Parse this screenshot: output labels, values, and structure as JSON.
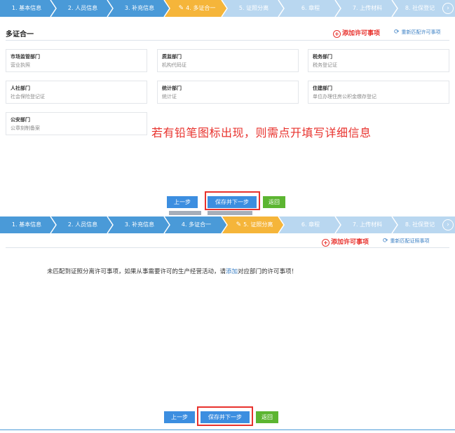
{
  "panel1": {
    "steps": [
      {
        "label": "1. 基本信息",
        "state": "done"
      },
      {
        "label": "2. 人员信息",
        "state": "done"
      },
      {
        "label": "3. 补充信息",
        "state": "done"
      },
      {
        "label": "4. 多证合一",
        "state": "current"
      },
      {
        "label": "5. 证照分离",
        "state": "todo"
      },
      {
        "label": "6. 章程",
        "state": "todo"
      },
      {
        "label": "7. 上传材料",
        "state": "todo"
      },
      {
        "label": "8. 社保登记",
        "state": "todo"
      }
    ],
    "next_arrow": "›",
    "section_title": "多证合一",
    "add_link": "添加许可事项",
    "rematch_link": "重新匹配许可事项",
    "cards": [
      {
        "dept": "市场监管部门",
        "license": "营业执照"
      },
      {
        "dept": "质监部门",
        "license": "机构代码证"
      },
      {
        "dept": "税务部门",
        "license": "税务登记证"
      },
      {
        "dept": "人社部门",
        "license": "社会保险登记证"
      },
      {
        "dept": "统计部门",
        "license": "统计证"
      },
      {
        "dept": "住建部门",
        "license": "单位办理住房公积金缴存登记"
      },
      {
        "dept": "公安部门",
        "license": "公章刻制备案"
      }
    ],
    "annotation": "若有铅笔图标出现，则需点开填写详细信息",
    "buttons": {
      "prev": "上一步",
      "save_next": "保存并下一步",
      "back": "返回"
    }
  },
  "panel2": {
    "steps": [
      {
        "label": "1. 基本信息",
        "state": "done"
      },
      {
        "label": "2. 人员信息",
        "state": "done"
      },
      {
        "label": "3. 补充信息",
        "state": "done"
      },
      {
        "label": "4. 多证合一",
        "state": "done"
      },
      {
        "label": "5. 证照分离",
        "state": "current"
      },
      {
        "label": "6. 章程",
        "state": "todo"
      },
      {
        "label": "7. 上传材料",
        "state": "todo"
      },
      {
        "label": "8. 社保登记",
        "state": "todo"
      }
    ],
    "next_arrow": "›",
    "add_link": "添加许可事项",
    "rematch_link": "重新匹配证照事项",
    "notice_before": "未匹配到证照分离许可事项，如果从事需要许可的生产经营活动，请",
    "notice_link": "添加",
    "notice_after": "对应部门的许可事项！",
    "buttons": {
      "prev": "上一步",
      "save_next": "保存并下一步",
      "back": "返回"
    }
  },
  "colors": {
    "step_bar": "#4a9ad8",
    "step_current": "#f5b53a",
    "step_todo": "#b9d7f0",
    "accent_red": "#e8322d",
    "button_blue": "#3c8ee0",
    "button_green": "#5cb531"
  }
}
